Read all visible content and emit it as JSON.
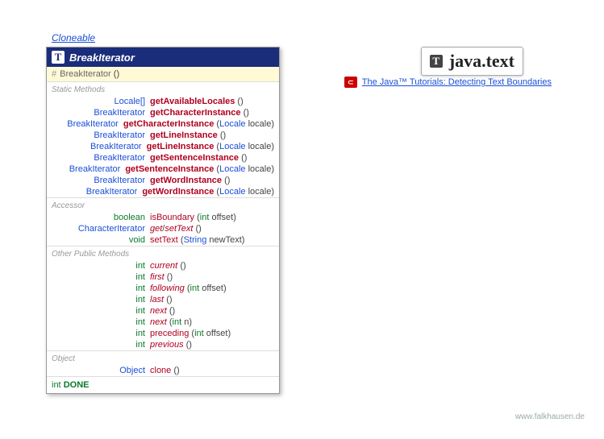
{
  "inheritance_link": "Cloneable",
  "class_name": "BreakIterator",
  "constructor": {
    "vis": "#",
    "name": "BreakIterator",
    "params": "()"
  },
  "sections": [
    {
      "label": "Static Methods",
      "methods": [
        {
          "ret": "Locale[]",
          "retKind": "type",
          "name": "getAvailableLocales",
          "nameStyle": "bold",
          "params": "()"
        },
        {
          "ret": "BreakIterator",
          "retKind": "type",
          "name": "getCharacterInstance",
          "nameStyle": "bold",
          "params": "()"
        },
        {
          "ret": "BreakIterator",
          "retKind": "type",
          "name": "getCharacterInstance",
          "nameStyle": "bold",
          "params": [
            [
              "Locale",
              "locale"
            ]
          ]
        },
        {
          "ret": "BreakIterator",
          "retKind": "type",
          "name": "getLineInstance",
          "nameStyle": "bold",
          "params": "()"
        },
        {
          "ret": "BreakIterator",
          "retKind": "type",
          "name": "getLineInstance",
          "nameStyle": "bold",
          "params": [
            [
              "Locale",
              "locale"
            ]
          ]
        },
        {
          "ret": "BreakIterator",
          "retKind": "type",
          "name": "getSentenceInstance",
          "nameStyle": "bold",
          "params": "()"
        },
        {
          "ret": "BreakIterator",
          "retKind": "type",
          "name": "getSentenceInstance",
          "nameStyle": "bold",
          "params": [
            [
              "Locale",
              "locale"
            ]
          ]
        },
        {
          "ret": "BreakIterator",
          "retKind": "type",
          "name": "getWordInstance",
          "nameStyle": "bold",
          "params": "()"
        },
        {
          "ret": "BreakIterator",
          "retKind": "type",
          "name": "getWordInstance",
          "nameStyle": "bold",
          "params": [
            [
              "Locale",
              "locale"
            ]
          ]
        }
      ]
    },
    {
      "label": "Accessor",
      "methods": [
        {
          "ret": "boolean",
          "retKind": "prim",
          "name": "isBoundary",
          "nameStyle": "plain",
          "params": [
            [
              "int",
              "offset"
            ]
          ]
        },
        {
          "ret": "CharacterIterator",
          "retKind": "type",
          "name": "get/setText",
          "nameStyle": "getset",
          "params": "()"
        },
        {
          "ret": "void",
          "retKind": "prim",
          "name": "setText",
          "nameStyle": "plain",
          "params": [
            [
              "String",
              "newText"
            ]
          ]
        }
      ]
    },
    {
      "label": "Other Public Methods",
      "methods": [
        {
          "ret": "int",
          "retKind": "prim",
          "name": "current",
          "nameStyle": "italic",
          "params": "()"
        },
        {
          "ret": "int",
          "retKind": "prim",
          "name": "first",
          "nameStyle": "italic",
          "params": "()"
        },
        {
          "ret": "int",
          "retKind": "prim",
          "name": "following",
          "nameStyle": "italic",
          "params": [
            [
              "int",
              "offset"
            ]
          ]
        },
        {
          "ret": "int",
          "retKind": "prim",
          "name": "last",
          "nameStyle": "italic",
          "params": "()"
        },
        {
          "ret": "int",
          "retKind": "prim",
          "name": "next",
          "nameStyle": "italic",
          "params": "()"
        },
        {
          "ret": "int",
          "retKind": "prim",
          "name": "next",
          "nameStyle": "italic",
          "params": [
            [
              "int",
              "n"
            ]
          ]
        },
        {
          "ret": "int",
          "retKind": "prim",
          "name": "preceding",
          "nameStyle": "plain",
          "params": [
            [
              "int",
              "offset"
            ]
          ]
        },
        {
          "ret": "int",
          "retKind": "prim",
          "name": "previous",
          "nameStyle": "italic",
          "params": "()"
        }
      ]
    },
    {
      "label": "Object",
      "methods": [
        {
          "ret": "Object",
          "retKind": "type",
          "name": "clone",
          "nameStyle": "plain",
          "params": "()"
        }
      ]
    }
  ],
  "constant": {
    "type": "int",
    "name": "DONE"
  },
  "package": {
    "icon": "T",
    "name": "java.text"
  },
  "tutorial": {
    "text": "The Java™ Tutorials: Detecting Text Boundaries"
  },
  "footer": "www.falkhausen.de"
}
